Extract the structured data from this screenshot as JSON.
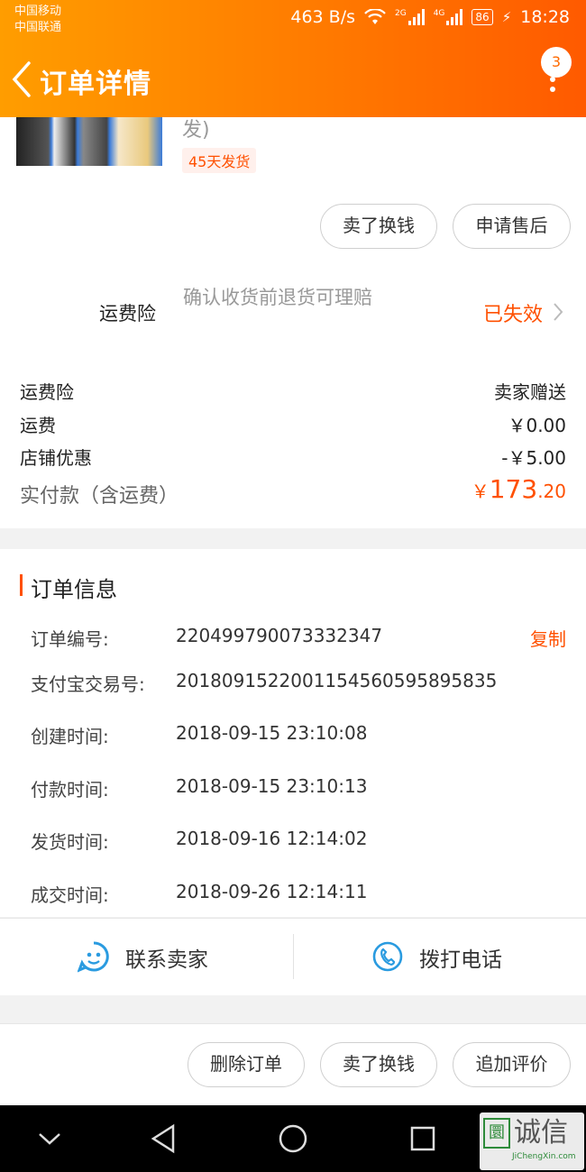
{
  "status_bar": {
    "carrier1": "中国移动",
    "carrier2": "中国联通",
    "net_speed": "463 B/s",
    "sig1_tag": "2G",
    "sig2_tag": "4G",
    "battery": "86",
    "time": "18:28"
  },
  "nav": {
    "title": "订单详情",
    "badge": "3"
  },
  "product": {
    "title_fragment": "发)",
    "ship_tag": "45天发货"
  },
  "item_actions": {
    "sell_label": "卖了换钱",
    "after_sale_label": "申请售后"
  },
  "insurance": {
    "label": "运费险",
    "desc": "确认收货前退货可理赔",
    "status": "已失效"
  },
  "summary": {
    "rows": [
      {
        "label": "运费险",
        "value": "卖家赠送"
      },
      {
        "label": "运费",
        "value": "￥0.00"
      },
      {
        "label": "店铺优惠",
        "value": "-￥5.00"
      }
    ],
    "total_label": "实付款（含运费）",
    "total_symbol": "￥",
    "total_int": "173",
    "total_dec": ".20"
  },
  "order_info": {
    "title": "订单信息",
    "copy_label": "复制",
    "rows": [
      {
        "label": "订单编号:",
        "value": "220499790073332347"
      },
      {
        "label": "支付宝交易号:",
        "value": "2018091522001154560595895835"
      },
      {
        "label": "创建时间:",
        "value": "2018-09-15 23:10:08"
      },
      {
        "label": "付款时间:",
        "value": "2018-09-15 23:10:13"
      },
      {
        "label": "发货时间:",
        "value": "2018-09-16 12:14:02"
      },
      {
        "label": "成交时间:",
        "value": "2018-09-26 12:14:11"
      }
    ]
  },
  "contact": {
    "seller_label": "联系卖家",
    "phone_label": "拨打电话"
  },
  "bottom_actions": {
    "delete_label": "删除订单",
    "sell_label": "卖了换钱",
    "review_label": "追加评价"
  },
  "watermark": {
    "brand": "诚信",
    "domain": "JiChengXin.com"
  },
  "colors": {
    "accent": "#ff5000",
    "header_start": "#ff9d00",
    "header_end": "#ff5a00",
    "icon_blue": "#2a9be0"
  }
}
